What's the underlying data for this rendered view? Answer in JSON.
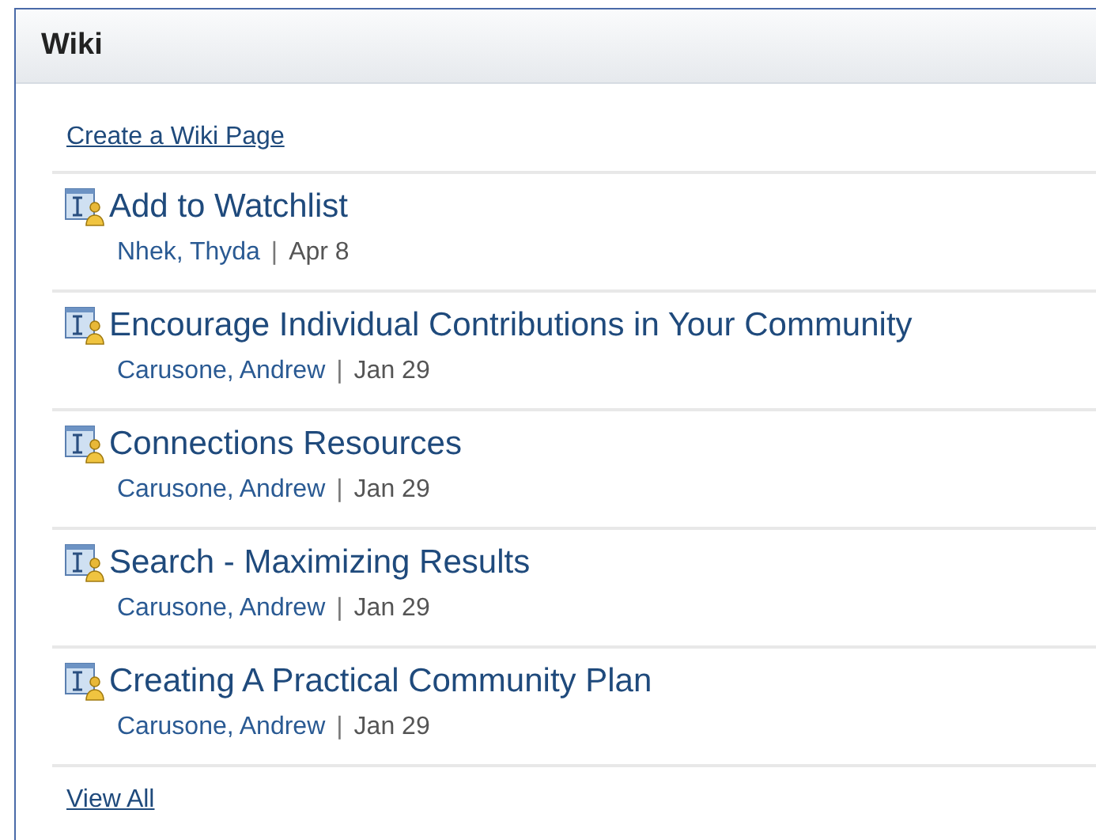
{
  "panel": {
    "title": "Wiki"
  },
  "create_link": "Create a Wiki Page",
  "pages": [
    {
      "title": "Add to Watchlist",
      "author": "Nhek, Thyda",
      "separator": "|",
      "date": "Apr 8"
    },
    {
      "title": "Encourage Individual Contributions in Your Community",
      "author": "Carusone, Andrew",
      "separator": "|",
      "date": "Jan 29"
    },
    {
      "title": "Connections Resources",
      "author": "Carusone, Andrew",
      "separator": "|",
      "date": "Jan 29"
    },
    {
      "title": "Search - Maximizing Results",
      "author": "Carusone, Andrew",
      "separator": "|",
      "date": "Jan 29"
    },
    {
      "title": "Creating A Practical Community Plan",
      "author": "Carusone, Andrew",
      "separator": "|",
      "date": "Jan 29"
    }
  ],
  "view_all": "View All"
}
